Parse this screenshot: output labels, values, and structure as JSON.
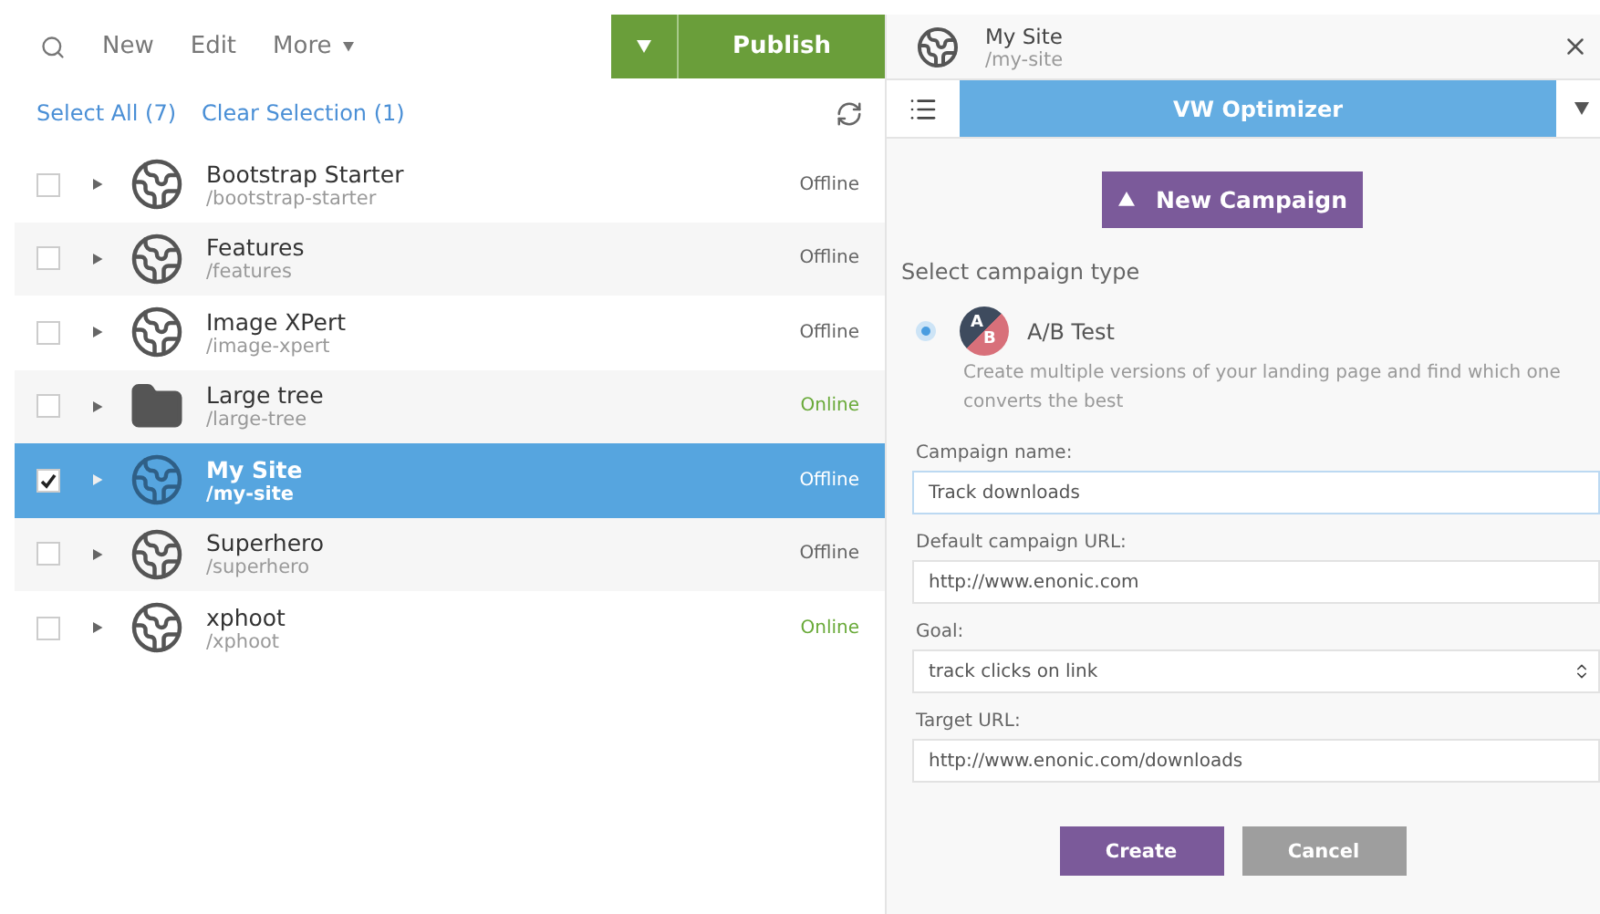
{
  "toolbar": {
    "actions": [
      "New",
      "Edit",
      "More"
    ],
    "publish": "Publish"
  },
  "selection_bar": {
    "select_all": "Select All (7)",
    "clear_selection": "Clear Selection (1)"
  },
  "items": [
    {
      "name": "Bootstrap Starter",
      "path": "/bootstrap-starter",
      "status": "Offline",
      "online": false,
      "kind": "site",
      "checked": false,
      "selected": false
    },
    {
      "name": "Features",
      "path": "/features",
      "status": "Offline",
      "online": false,
      "kind": "site",
      "checked": false,
      "selected": false
    },
    {
      "name": "Image XPert",
      "path": "/image-xpert",
      "status": "Offline",
      "online": false,
      "kind": "site",
      "checked": false,
      "selected": false
    },
    {
      "name": "Large tree",
      "path": "/large-tree",
      "status": "Online",
      "online": true,
      "kind": "folder",
      "checked": false,
      "selected": false
    },
    {
      "name": "My Site",
      "path": "/my-site",
      "status": "Offline",
      "online": false,
      "kind": "site",
      "checked": true,
      "selected": true
    },
    {
      "name": "Superhero",
      "path": "/superhero",
      "status": "Offline",
      "online": false,
      "kind": "site",
      "checked": false,
      "selected": false
    },
    {
      "name": "xphoot",
      "path": "/xphoot",
      "status": "Online",
      "online": true,
      "kind": "site",
      "checked": false,
      "selected": false
    }
  ],
  "details": {
    "title": "My Site",
    "path": "/my-site",
    "widget": "VW Optimizer",
    "new_campaign": "New Campaign",
    "section_label": "Select campaign type",
    "campaign_types": [
      {
        "label": "A/B Test",
        "badge_a": "A",
        "badge_b": "B",
        "description": "Create multiple versions of your landing page and find which one converts the best",
        "selected": true
      }
    ],
    "fields": [
      {
        "kind": "text",
        "label": "Campaign name:",
        "value": "Track downloads",
        "focused": true
      },
      {
        "kind": "text",
        "label": "Default campaign URL:",
        "value": "http://www.enonic.com",
        "focused": false
      },
      {
        "kind": "select",
        "label": "Goal:",
        "value": "track clicks on link",
        "focused": false
      },
      {
        "kind": "text",
        "label": "Target URL:",
        "value": "http://www.enonic.com/downloads",
        "focused": false
      }
    ],
    "buttons": [
      "Create",
      "Cancel"
    ]
  }
}
